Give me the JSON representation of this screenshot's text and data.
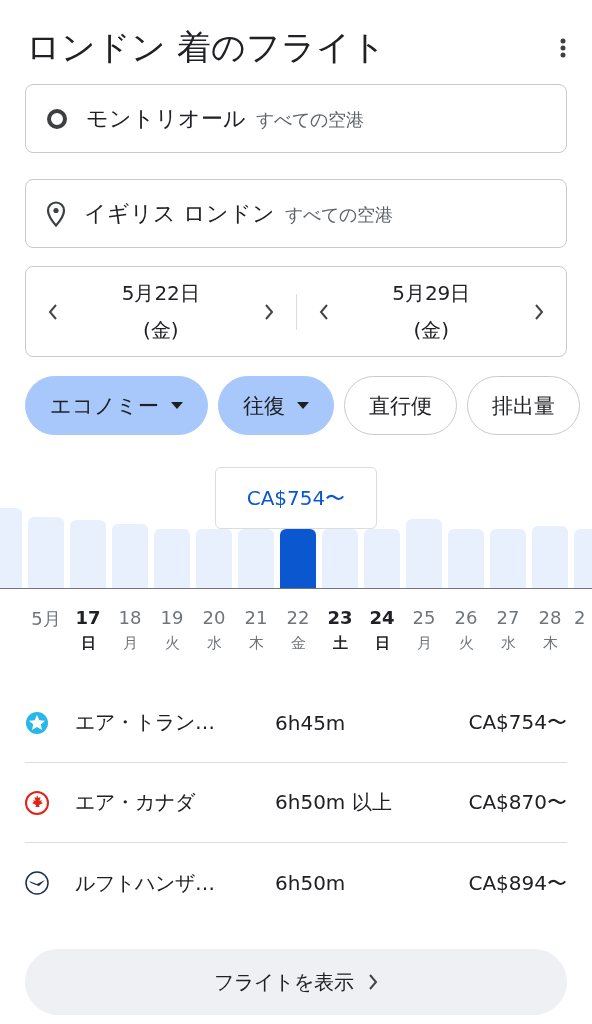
{
  "header": {
    "title": "ロンドン 着のフライト"
  },
  "origin": {
    "value": "モントリオール",
    "hint": "すべての空港"
  },
  "destination": {
    "value": "イギリス ロンドン",
    "hint": "すべての空港"
  },
  "dates": [
    {
      "date": "5月22日",
      "weekday": "(金)"
    },
    {
      "date": "5月29日",
      "weekday": "(金)"
    }
  ],
  "chips": [
    {
      "label": "エコノミー",
      "selected": true,
      "kind": "dropdown"
    },
    {
      "label": "往復",
      "selected": true,
      "kind": "dropdown"
    },
    {
      "label": "直行便",
      "selected": false,
      "kind": "toggle"
    },
    {
      "label": "排出量",
      "selected": false,
      "kind": "toggle"
    }
  ],
  "price_chart": {
    "tooltip": "CA$754〜",
    "bars": [
      {
        "selected": false
      },
      {
        "selected": false
      },
      {
        "selected": false
      },
      {
        "selected": false
      },
      {
        "selected": false
      },
      {
        "selected": false
      },
      {
        "selected": false
      },
      {
        "selected": true
      },
      {
        "selected": false
      },
      {
        "selected": false
      },
      {
        "selected": false
      },
      {
        "selected": false
      },
      {
        "selected": false
      },
      {
        "selected": false
      },
      {
        "selected": false
      }
    ],
    "days": [
      {
        "day": "5月",
        "bold": false
      },
      {
        "day": "17",
        "weekday": "日",
        "bold": true
      },
      {
        "day": "18",
        "weekday": "月",
        "bold": false
      },
      {
        "day": "19",
        "weekday": "火",
        "bold": false
      },
      {
        "day": "20",
        "weekday": "水",
        "bold": false
      },
      {
        "day": "21",
        "weekday": "木",
        "bold": false
      },
      {
        "day": "22",
        "weekday": "金",
        "bold": false
      },
      {
        "day": "23",
        "weekday": "土",
        "bold": true
      },
      {
        "day": "24",
        "weekday": "日",
        "bold": true
      },
      {
        "day": "25",
        "weekday": "月",
        "bold": false
      },
      {
        "day": "26",
        "weekday": "火",
        "bold": false
      },
      {
        "day": "27",
        "weekday": "水",
        "bold": false
      },
      {
        "day": "28",
        "weekday": "木",
        "bold": false
      },
      {
        "day": "2",
        "bold": false
      }
    ]
  },
  "flights": [
    {
      "airline": "エア・トラン…",
      "kind": "star",
      "duration": "6h45m",
      "price": "CA$754〜"
    },
    {
      "airline": "エア・カナダ",
      "kind": "leaf",
      "duration": "6h50m 以上",
      "price": "CA$870〜"
    },
    {
      "airline": "ルフトハンザ…",
      "kind": "crane",
      "duration": "6h50m",
      "price": "CA$894〜"
    }
  ],
  "button": {
    "label": "フライトを表示"
  }
}
